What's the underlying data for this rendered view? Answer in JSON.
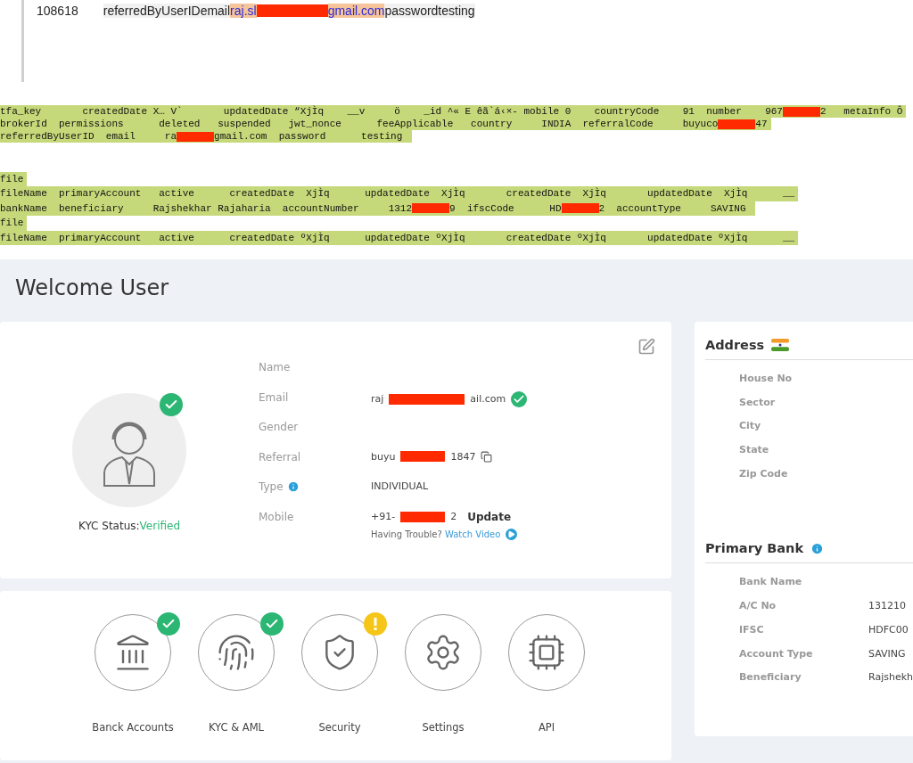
{
  "document_row": {
    "id": "108618",
    "segments": [
      {
        "kind": "text",
        "text": "referredByUserIDemail"
      },
      {
        "kind": "link",
        "text": "raj.sl"
      },
      {
        "kind": "redaction"
      },
      {
        "kind": "link",
        "text": "gmail.com"
      },
      {
        "kind": "text",
        "text": "passwordtesting"
      }
    ]
  },
  "dump_blocks": [
    [
      [
        {
          "kind": "text",
          "text": "tfa_key       createdDate X… V`       updatedDate “XjÌq    __v     ö    _id ^« E êã`á‹×- mobile 0    countryCode    91  number    967"
        },
        {
          "kind": "redaction"
        },
        {
          "kind": "text",
          "text": "2   metaInfo Ô"
        }
      ],
      [
        {
          "kind": "text",
          "text": "brokerId  permissions      deleted   suspended   jwt_nonce      feeApplicable   country     INDIA  referralCode     buyuco"
        },
        {
          "kind": "redaction"
        },
        {
          "kind": "text",
          "text": "47"
        }
      ],
      [
        {
          "kind": "text",
          "text": "referredByUserID  email     ra"
        },
        {
          "kind": "redaction"
        },
        {
          "kind": "text",
          "text": "gmail.com  password      testing "
        }
      ]
    ],
    [
      [
        {
          "kind": "text",
          "text": "file"
        }
      ],
      [
        {
          "kind": "text",
          "text": "fileName  primaryAccount   active      createdDate  XjÌq      updatedDate  XjÌq       createdDate  XjÌq       updatedDate  XjÌq      __"
        }
      ],
      [
        {
          "kind": "text",
          "text": "bankName  beneficiary     Rajshekhar Rajaharia  accountNumber     1312"
        },
        {
          "kind": "redaction"
        },
        {
          "kind": "text",
          "text": "9  ifscCode      HD"
        },
        {
          "kind": "redaction"
        },
        {
          "kind": "text",
          "text": "2  accountType     SAVING "
        }
      ],
      [
        {
          "kind": "text",
          "text": "file"
        }
      ],
      [
        {
          "kind": "text",
          "text": "fileName  primaryAccount   active      createdDate ºXjÌq      updatedDate ºXjÌq       createdDate ºXjÌq       updatedDate ºXjÌq      __"
        }
      ]
    ]
  ],
  "dashboard": {
    "title": "Welcome User",
    "profile": {
      "avatar_verified": true,
      "kyc": {
        "label": "KYC Status:",
        "status": "Verified"
      },
      "fields": [
        {
          "label": "Name"
        },
        {
          "label": "Email",
          "value": [
            {
              "kind": "text",
              "text": "raj"
            },
            {
              "kind": "redaction"
            },
            {
              "kind": "text",
              "text": "ail.com"
            }
          ],
          "verified": true
        },
        {
          "label": "Gender"
        },
        {
          "label": "Referral",
          "value": [
            {
              "kind": "text",
              "text": "buyu"
            },
            {
              "kind": "redaction"
            },
            {
              "kind": "text",
              "text": "1847"
            }
          ],
          "copyable": true
        },
        {
          "label": "Type",
          "info": true,
          "value": [
            {
              "kind": "text",
              "text": "INDIVIDUAL"
            }
          ]
        },
        {
          "label": "Mobile",
          "value": [
            {
              "kind": "text",
              "text": "+91-"
            },
            {
              "kind": "redaction"
            },
            {
              "kind": "text",
              "text": "2"
            }
          ],
          "action": "Update",
          "help": {
            "text": "Having Trouble?",
            "link": "Watch Video"
          }
        }
      ]
    },
    "tiles": [
      {
        "label": "Banck Accounts",
        "kind": "bank",
        "verified": true,
        "warning": false
      },
      {
        "label": "KYC & AML",
        "kind": "fingerprint",
        "verified": true,
        "warning": false
      },
      {
        "label": "Security",
        "kind": "shield",
        "verified": false,
        "warning": true
      },
      {
        "label": "Settings",
        "kind": "gear",
        "verified": false,
        "warning": false
      },
      {
        "label": "API",
        "kind": "chip",
        "verified": false,
        "warning": false
      }
    ],
    "address": {
      "title": "Address",
      "fields": [
        {
          "label": "House No"
        },
        {
          "label": "Sector"
        },
        {
          "label": "City"
        },
        {
          "label": "State"
        },
        {
          "label": "Zip Code"
        }
      ]
    },
    "bank": {
      "title": "Primary Bank",
      "fields": [
        {
          "label": "Bank Name"
        },
        {
          "label": "A/C No",
          "value": "131210"
        },
        {
          "label": "IFSC",
          "value": "HDFC00"
        },
        {
          "label": "Account Type",
          "value": "SAVING"
        },
        {
          "label": "Beneficiary",
          "value": "Rajshekh"
        }
      ]
    }
  }
}
